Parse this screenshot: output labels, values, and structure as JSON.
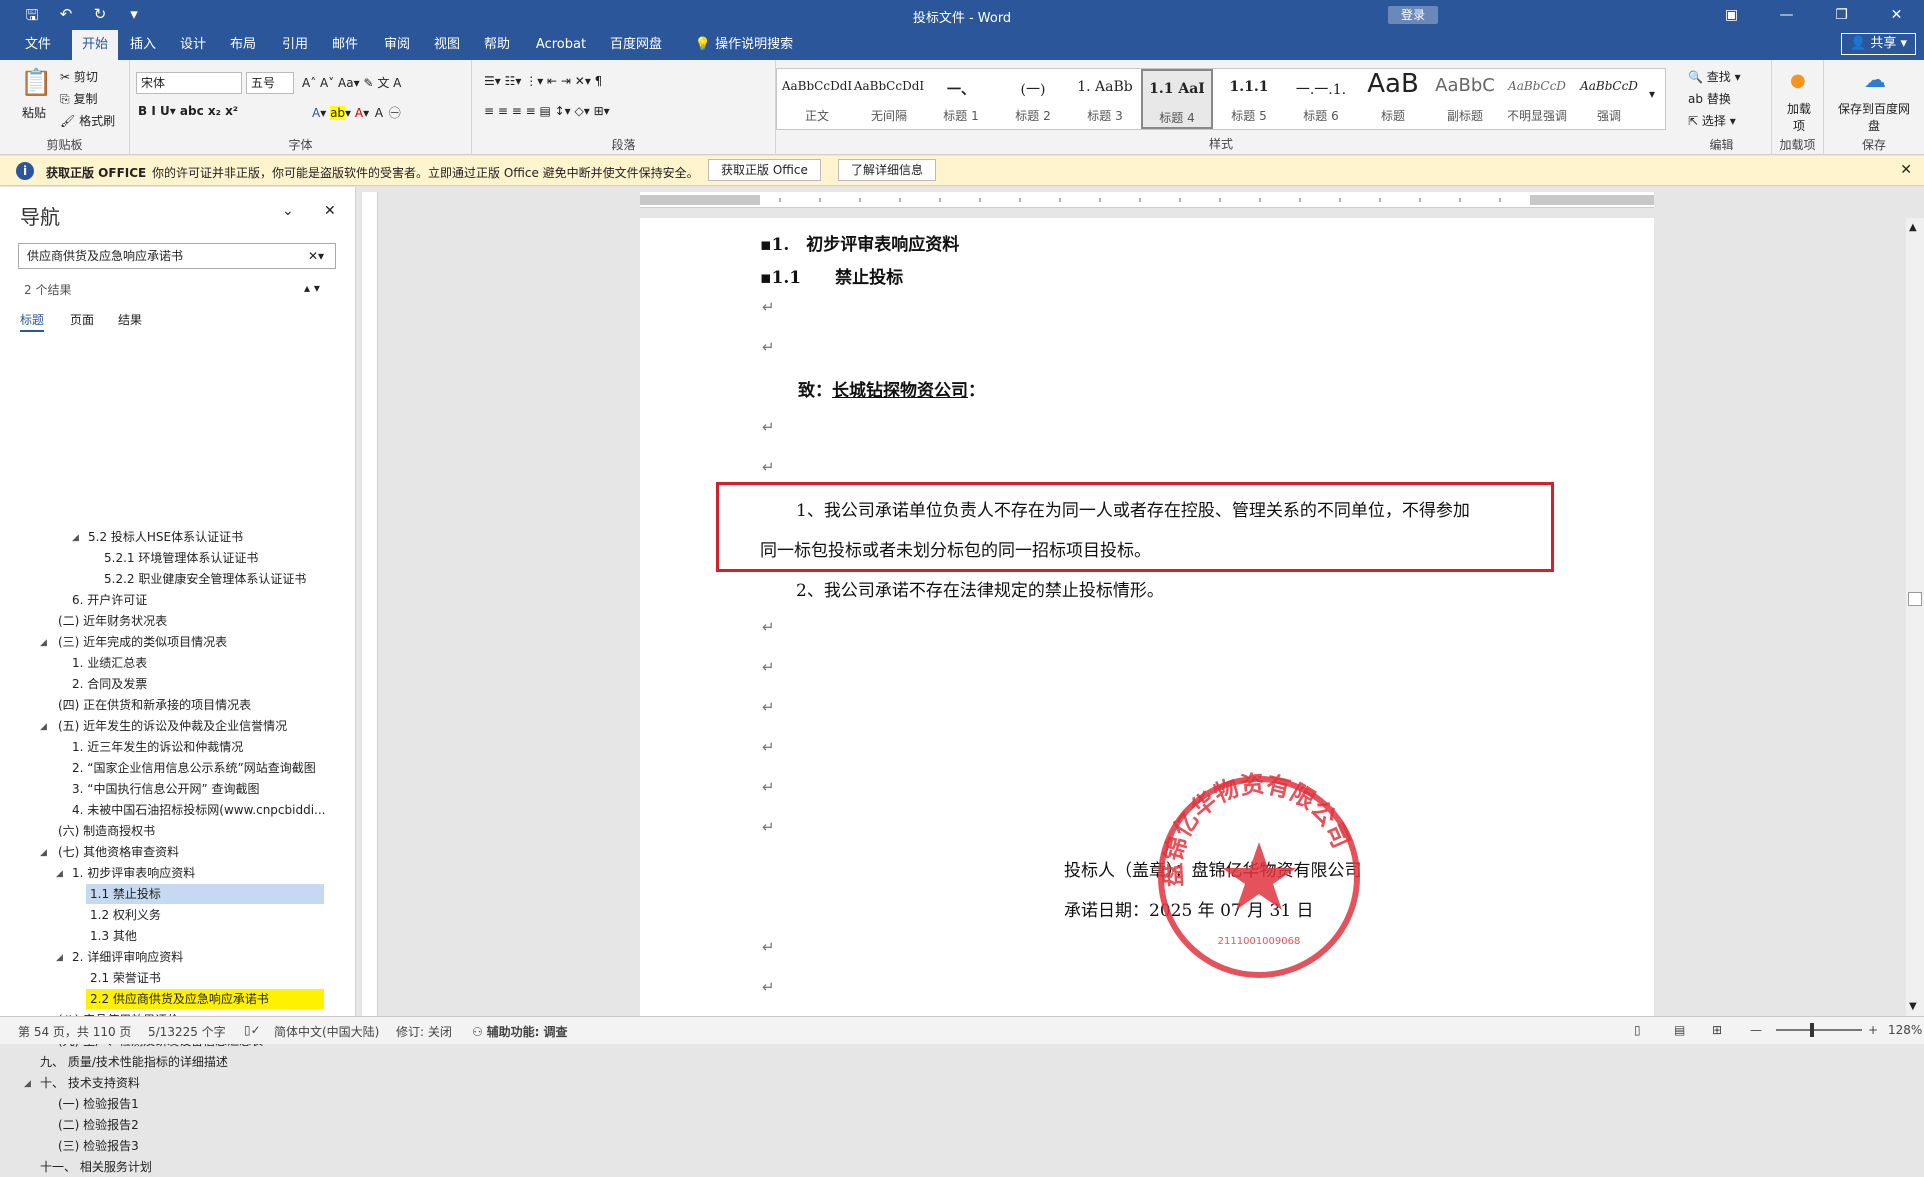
{
  "window": {
    "title": "投标文件 - Word",
    "signin_label": "登录"
  },
  "ribbon_tabs": [
    "文件",
    "开始",
    "插入",
    "设计",
    "布局",
    "引用",
    "邮件",
    "审阅",
    "视图",
    "帮助",
    "Acrobat",
    "百度网盘",
    "操作说明搜索"
  ],
  "share_label": "共享",
  "clipboard": {
    "paste": "粘贴",
    "cut": "剪切",
    "copy": "复制",
    "format_painter": "格式刷",
    "label": "剪贴板"
  },
  "font": {
    "name": "宋体",
    "size": "五号",
    "label": "字体"
  },
  "paragraph": {
    "label": "段落"
  },
  "styles": {
    "label": "样式",
    "items": [
      {
        "preview": "AaBbCcDdI",
        "name": "正文"
      },
      {
        "preview": "AaBbCcDdI",
        "name": "无间隔"
      },
      {
        "preview": "一、",
        "name": "标题 1"
      },
      {
        "preview": "(一)",
        "name": "标题 2"
      },
      {
        "preview": "1. AaBb",
        "name": "标题 3"
      },
      {
        "preview": "1.1 AaI",
        "name": "标题 4"
      },
      {
        "preview": "1.1.1",
        "name": "标题 5"
      },
      {
        "preview": "一.一.1.",
        "name": "标题 6"
      },
      {
        "preview": "AaB",
        "name": "标题"
      },
      {
        "preview": "AaBbC",
        "name": "副标题"
      },
      {
        "preview": "AaBbCcD",
        "name": "不明显强调"
      },
      {
        "preview": "AaBbCcD",
        "name": "强调"
      }
    ]
  },
  "editing": {
    "find": "查找",
    "replace": "替换",
    "select": "选择",
    "label": "编辑"
  },
  "addins": {
    "button": "加载项",
    "label": "加载项"
  },
  "save": {
    "button": "保存到百度网盘",
    "label": "保存"
  },
  "infobar": {
    "title": "获取正版 OFFICE",
    "message": "你的许可证并非正版，你可能是盗版软件的受害者。立即通过正版 Office 避免中断并使文件保持安全。",
    "btn1": "获取正版 Office",
    "btn2": "了解详细信息"
  },
  "nav": {
    "title": "导航",
    "search": "供应商供货及应急响应承诺书",
    "results": "2 个结果",
    "tabs": [
      "标题",
      "页面",
      "结果"
    ],
    "items": [
      "5.2 投标人HSE体系认证证书",
      "5.2.1 环境管理体系认证证书",
      "5.2.2 职业健康安全管理体系认证证书",
      "6. 开户许可证",
      "(二) 近年财务状况表",
      "(三) 近年完成的类似项目情况表",
      "1. 业绩汇总表",
      "2. 合同及发票",
      "(四) 正在供货和新承接的项目情况表",
      "(五) 近年发生的诉讼及仲裁及企业信誉情况",
      "1. 近三年发生的诉讼和仲裁情况",
      "2. “国家企业信用信息公示系统”网站查询截图",
      "3. “中国执行信息公开网” 查询截图",
      "4. 未被中国石油招标投标网(www.cnpcbiddi...",
      "(六) 制造商授权书",
      "(七) 其他资格审查资料",
      "1. 初步评审表响应资料",
      "1.1 禁止投标",
      "1.2 权利义务",
      "1.3 其他",
      "2. 详细评审响应资料",
      "2.1 荣誉证书",
      "2.2 供应商供货及应急响应承诺书",
      "(八) 产品使用效果评价",
      "(九) 生产、检测及研发设备信息汇总表",
      "九、 质量/技术性能指标的详细描述",
      "十、 技术支持资料",
      "(一) 检验报告1",
      "(二) 检验报告2",
      "(三) 检验报告3",
      "十一、 相关服务计划"
    ]
  },
  "document": {
    "h1": "1.　初步评审表响应资料",
    "h2": "1.1　　禁止投标",
    "to_prefix": "致：",
    "to_company": "长城钻探物资公司",
    "to_suffix": "：",
    "p1_line1": "1、我公司承诺单位负责人不存在为同一人或者存在控股、管理关系的不同单位，不得参加",
    "p1_line2": "同一标包投标或者未划分标包的同一招标项目投标。",
    "p2": "2、我公司承诺不存在法律规定的禁止投标情形。",
    "bidder": "投标人（盖章）：盘锦亿华物资有限公司",
    "date": "承诺日期：2025 年 07 月 31 日",
    "seal_text": "盘锦亿华物资有限公司",
    "seal_number": "2111001009068",
    "seal_color": "#e0343e"
  },
  "status": {
    "page": "第 54 页，共 110 页",
    "words": "5/13225 个字",
    "lang": "简体中文(中国大陆)",
    "track": "修订: 关闭",
    "access": "辅助功能: 调查",
    "zoom": "128%"
  }
}
